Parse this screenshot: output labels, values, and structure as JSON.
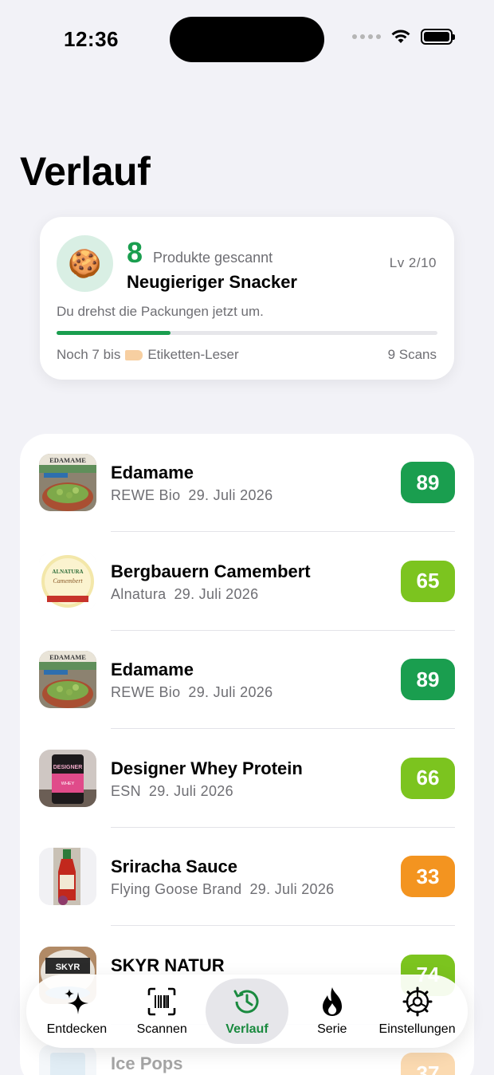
{
  "status_bar": {
    "time": "12:36"
  },
  "page": {
    "title": "Verlauf"
  },
  "level_card": {
    "emoji": "🍪",
    "count": "8",
    "count_label": "Produkte gescannt",
    "level_name": "Neugieriger Snacker",
    "level": "Lv 2/10",
    "description": "Du drehst die Packungen jetzt um.",
    "progress_fraction": 0.3,
    "next_prefix": "Noch 7 bis",
    "next_title": "Etiketten-Leser",
    "next_icon": "tag-icon",
    "scans_total": "9 Scans"
  },
  "history": [
    {
      "name": "Edamame",
      "brand": "REWE Bio",
      "date": "29. Juli 2026",
      "score": "89",
      "score_color": "#1a9e4f",
      "thumb": "edamame"
    },
    {
      "name": "Bergbauern Camembert",
      "brand": "Alnatura",
      "date": "29. Juli 2026",
      "score": "65",
      "score_color": "#7cc41f",
      "thumb": "camembert"
    },
    {
      "name": "Edamame",
      "brand": "REWE Bio",
      "date": "29. Juli 2026",
      "score": "89",
      "score_color": "#1a9e4f",
      "thumb": "edamame"
    },
    {
      "name": "Designer Whey Protein",
      "brand": "ESN",
      "date": "29. Juli 2026",
      "score": "66",
      "score_color": "#7cc41f",
      "thumb": "whey"
    },
    {
      "name": "Sriracha Sauce",
      "brand": "Flying Goose Brand",
      "date": "29. Juli 2026",
      "score": "33",
      "score_color": "#f39420",
      "thumb": "sriracha"
    },
    {
      "name": "SKYR NATUR",
      "brand": "",
      "date": "",
      "score": "74",
      "score_color": "#7cc41f",
      "thumb": "skyr"
    },
    {
      "name": "Ice Pops",
      "brand": "",
      "date": "",
      "score": "37",
      "score_color": "#f39420",
      "thumb": "icepops"
    }
  ],
  "tabs": [
    {
      "label": "Entdecken",
      "icon": "sparkles-icon",
      "active": false
    },
    {
      "label": "Scannen",
      "icon": "barcode-scan-icon",
      "active": false
    },
    {
      "label": "Verlauf",
      "icon": "history-clock-icon",
      "active": true
    },
    {
      "label": "Serie",
      "icon": "flame-icon",
      "active": false
    },
    {
      "label": "Einstellungen",
      "icon": "gear-icon",
      "active": false
    }
  ],
  "colors": {
    "accent_green": "#1a9e4f",
    "score_dark_green": "#1a9e4f",
    "score_light_green": "#7cc41f",
    "score_orange": "#f39420",
    "background": "#f2f2f7"
  }
}
